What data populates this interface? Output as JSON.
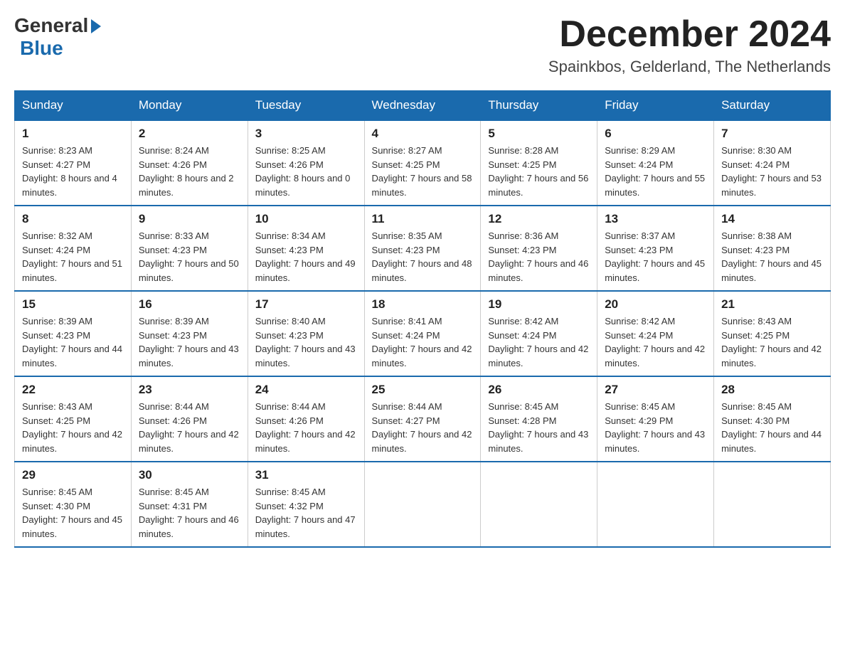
{
  "logo": {
    "general": "General",
    "blue": "Blue"
  },
  "title": "December 2024",
  "location": "Spainkbos, Gelderland, The Netherlands",
  "days_of_week": [
    "Sunday",
    "Monday",
    "Tuesday",
    "Wednesday",
    "Thursday",
    "Friday",
    "Saturday"
  ],
  "weeks": [
    [
      {
        "day": 1,
        "sunrise": "8:23 AM",
        "sunset": "4:27 PM",
        "daylight": "8 hours and 4 minutes."
      },
      {
        "day": 2,
        "sunrise": "8:24 AM",
        "sunset": "4:26 PM",
        "daylight": "8 hours and 2 minutes."
      },
      {
        "day": 3,
        "sunrise": "8:25 AM",
        "sunset": "4:26 PM",
        "daylight": "8 hours and 0 minutes."
      },
      {
        "day": 4,
        "sunrise": "8:27 AM",
        "sunset": "4:25 PM",
        "daylight": "7 hours and 58 minutes."
      },
      {
        "day": 5,
        "sunrise": "8:28 AM",
        "sunset": "4:25 PM",
        "daylight": "7 hours and 56 minutes."
      },
      {
        "day": 6,
        "sunrise": "8:29 AM",
        "sunset": "4:24 PM",
        "daylight": "7 hours and 55 minutes."
      },
      {
        "day": 7,
        "sunrise": "8:30 AM",
        "sunset": "4:24 PM",
        "daylight": "7 hours and 53 minutes."
      }
    ],
    [
      {
        "day": 8,
        "sunrise": "8:32 AM",
        "sunset": "4:24 PM",
        "daylight": "7 hours and 51 minutes."
      },
      {
        "day": 9,
        "sunrise": "8:33 AM",
        "sunset": "4:23 PM",
        "daylight": "7 hours and 50 minutes."
      },
      {
        "day": 10,
        "sunrise": "8:34 AM",
        "sunset": "4:23 PM",
        "daylight": "7 hours and 49 minutes."
      },
      {
        "day": 11,
        "sunrise": "8:35 AM",
        "sunset": "4:23 PM",
        "daylight": "7 hours and 48 minutes."
      },
      {
        "day": 12,
        "sunrise": "8:36 AM",
        "sunset": "4:23 PM",
        "daylight": "7 hours and 46 minutes."
      },
      {
        "day": 13,
        "sunrise": "8:37 AM",
        "sunset": "4:23 PM",
        "daylight": "7 hours and 45 minutes."
      },
      {
        "day": 14,
        "sunrise": "8:38 AM",
        "sunset": "4:23 PM",
        "daylight": "7 hours and 45 minutes."
      }
    ],
    [
      {
        "day": 15,
        "sunrise": "8:39 AM",
        "sunset": "4:23 PM",
        "daylight": "7 hours and 44 minutes."
      },
      {
        "day": 16,
        "sunrise": "8:39 AM",
        "sunset": "4:23 PM",
        "daylight": "7 hours and 43 minutes."
      },
      {
        "day": 17,
        "sunrise": "8:40 AM",
        "sunset": "4:23 PM",
        "daylight": "7 hours and 43 minutes."
      },
      {
        "day": 18,
        "sunrise": "8:41 AM",
        "sunset": "4:24 PM",
        "daylight": "7 hours and 42 minutes."
      },
      {
        "day": 19,
        "sunrise": "8:42 AM",
        "sunset": "4:24 PM",
        "daylight": "7 hours and 42 minutes."
      },
      {
        "day": 20,
        "sunrise": "8:42 AM",
        "sunset": "4:24 PM",
        "daylight": "7 hours and 42 minutes."
      },
      {
        "day": 21,
        "sunrise": "8:43 AM",
        "sunset": "4:25 PM",
        "daylight": "7 hours and 42 minutes."
      }
    ],
    [
      {
        "day": 22,
        "sunrise": "8:43 AM",
        "sunset": "4:25 PM",
        "daylight": "7 hours and 42 minutes."
      },
      {
        "day": 23,
        "sunrise": "8:44 AM",
        "sunset": "4:26 PM",
        "daylight": "7 hours and 42 minutes."
      },
      {
        "day": 24,
        "sunrise": "8:44 AM",
        "sunset": "4:26 PM",
        "daylight": "7 hours and 42 minutes."
      },
      {
        "day": 25,
        "sunrise": "8:44 AM",
        "sunset": "4:27 PM",
        "daylight": "7 hours and 42 minutes."
      },
      {
        "day": 26,
        "sunrise": "8:45 AM",
        "sunset": "4:28 PM",
        "daylight": "7 hours and 43 minutes."
      },
      {
        "day": 27,
        "sunrise": "8:45 AM",
        "sunset": "4:29 PM",
        "daylight": "7 hours and 43 minutes."
      },
      {
        "day": 28,
        "sunrise": "8:45 AM",
        "sunset": "4:30 PM",
        "daylight": "7 hours and 44 minutes."
      }
    ],
    [
      {
        "day": 29,
        "sunrise": "8:45 AM",
        "sunset": "4:30 PM",
        "daylight": "7 hours and 45 minutes."
      },
      {
        "day": 30,
        "sunrise": "8:45 AM",
        "sunset": "4:31 PM",
        "daylight": "7 hours and 46 minutes."
      },
      {
        "day": 31,
        "sunrise": "8:45 AM",
        "sunset": "4:32 PM",
        "daylight": "7 hours and 47 minutes."
      },
      null,
      null,
      null,
      null
    ]
  ]
}
